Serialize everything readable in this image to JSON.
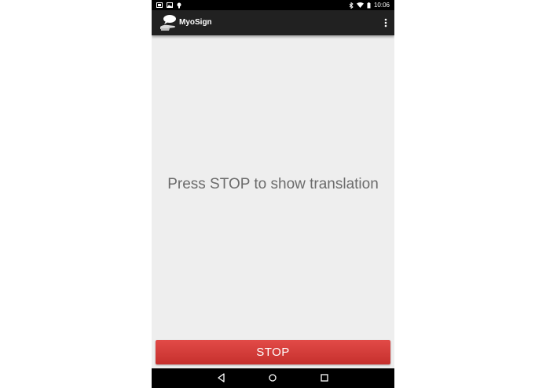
{
  "status_bar": {
    "time": "10:06",
    "left_icons": [
      "photo-icon",
      "image-icon",
      "lightbulb-icon"
    ],
    "right_icons": [
      "bluetooth-icon",
      "wifi-icon",
      "battery-icon"
    ]
  },
  "app_bar": {
    "title": "MyoSign",
    "logo_icon": "myosign-logo-icon",
    "menu_icon": "overflow-menu-icon"
  },
  "main": {
    "message": "Press STOP to show translation"
  },
  "action": {
    "stop_label": "STOP",
    "color": "#d63c39"
  },
  "nav_bar": {
    "icons": [
      "back-icon",
      "home-icon",
      "recents-icon"
    ]
  },
  "colors": {
    "status_bar": "#000000",
    "app_bar": "#212121",
    "background": "#eeeeee",
    "text": "#6b6b6b"
  }
}
